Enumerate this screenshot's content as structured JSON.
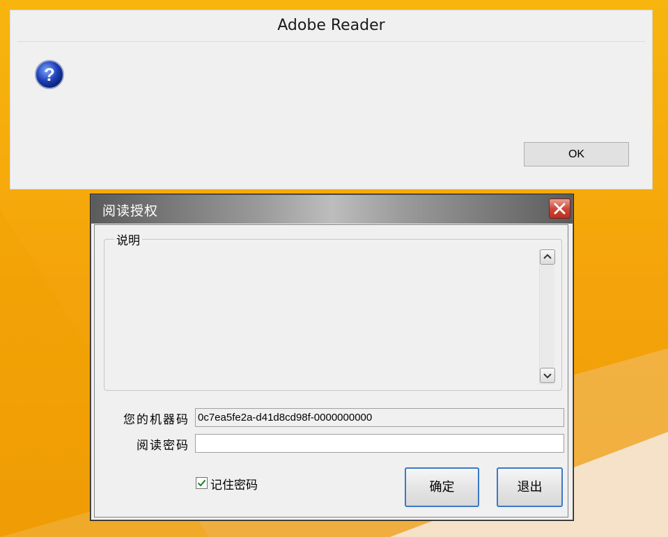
{
  "adobe_dialog": {
    "title": "Adobe Reader",
    "ok_label": "OK",
    "icon": "question-icon"
  },
  "auth_dialog": {
    "title": "阅读授权",
    "group_label": "说明",
    "machine_code_label": "您的机器码",
    "machine_code_value": "0c7ea5fe2a-d41d8cd98f-0000000000",
    "password_label": "阅读密码",
    "password_value": "",
    "remember_label": "记住密码",
    "remember_checked": true,
    "ok_label": "确定",
    "exit_label": "退出"
  },
  "colors": {
    "desktop": "#f5a60a",
    "button_border": "#3b78c7",
    "close_red": "#d0473a"
  }
}
